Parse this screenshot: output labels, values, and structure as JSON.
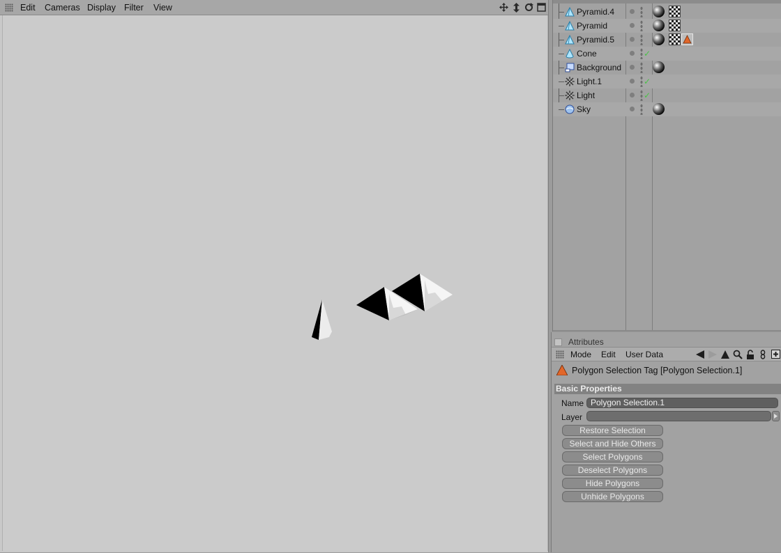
{
  "viewport": {
    "menu": [
      "Edit",
      "Cameras",
      "Display",
      "Filter",
      "View"
    ],
    "tool_icons": [
      "move-icon",
      "zoom-icon",
      "rotate-icon",
      "maximize-icon"
    ]
  },
  "object_manager": {
    "objects": [
      {
        "name": "Pyramid.4",
        "icon": "pyramid-icon",
        "check": "",
        "tags": [
          "material-tag",
          "texture-tag"
        ]
      },
      {
        "name": "Pyramid",
        "icon": "pyramid-icon",
        "check": "",
        "tags": [
          "material-tag",
          "texture-tag"
        ]
      },
      {
        "name": "Pyramid.5",
        "icon": "pyramid-icon",
        "check": "",
        "tags": [
          "material-tag",
          "texture-tag",
          "polygon-selection-tag"
        ]
      },
      {
        "name": "Cone",
        "icon": "cone-icon",
        "check": "✓",
        "tags": []
      },
      {
        "name": "Background",
        "icon": "background-icon",
        "check": "",
        "tags": [
          "material-tag"
        ]
      },
      {
        "name": "Light.1",
        "icon": "light-icon",
        "check": "✓",
        "tags": []
      },
      {
        "name": "Light",
        "icon": "light-icon",
        "check": "✓",
        "tags": []
      },
      {
        "name": "Sky",
        "icon": "sky-icon",
        "check": "",
        "tags": [
          "material-tag"
        ]
      }
    ]
  },
  "attributes": {
    "title": "Attributes",
    "menu": [
      "Mode",
      "Edit",
      "User Data"
    ],
    "tool_icons": [
      "back-arrow-icon",
      "forward-arrow-icon",
      "up-arrow-icon",
      "search-icon",
      "lock-icon",
      "link-icon",
      "new-window-icon"
    ],
    "tag_header": "Polygon Selection Tag [Polygon Selection.1]",
    "section": "Basic Properties",
    "name_label": "Name",
    "name_value": "Polygon Selection.1",
    "layer_label": "Layer",
    "layer_value": "",
    "buttons": [
      "Restore Selection",
      "Select and Hide Others",
      "Select Polygons",
      "Deselect Polygons",
      "Hide Polygons",
      "Unhide Polygons"
    ]
  },
  "colors": {
    "viewport_bg": "#cbcbcb",
    "panel_bg": "#a2a2a2",
    "selection_tag_orange": "#e2672a",
    "check_green": "#49c246"
  }
}
